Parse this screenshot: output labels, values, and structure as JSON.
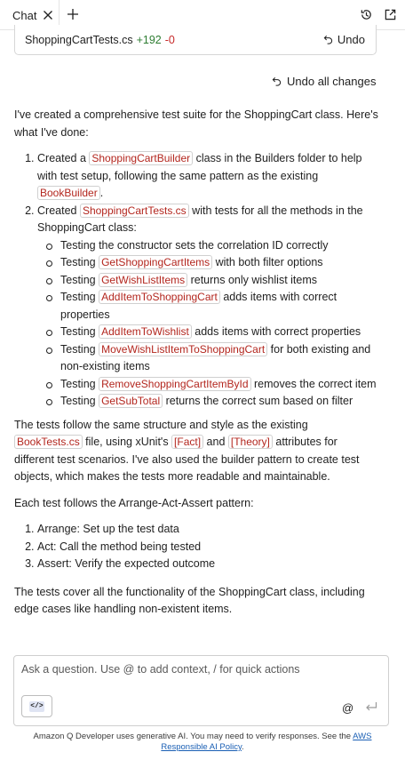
{
  "tabs": {
    "chat_label": "Chat",
    "add_icon": "plus-icon",
    "history_icon": "history-icon",
    "popout_icon": "open-in-new-window-icon"
  },
  "file_change": {
    "file_name": "ShoppingCartTests.cs",
    "added": "+192",
    "removed": "-0",
    "undo_label": "Undo"
  },
  "undo_all_label": "Undo all changes",
  "message": {
    "intro": "I've created a comprehensive test suite for the ShoppingCart class. Here's what I've done:",
    "step1": {
      "t1": "Created a ",
      "c1": "ShoppingCartBuilder",
      "t2": " class in the Builders folder to help with test setup, following the same pattern as the existing ",
      "c2": "BookBuilder",
      "t3": "."
    },
    "step2": {
      "t1": "Created ",
      "c1": "ShoppingCartTests.cs",
      "t2": " with tests for all the methods in the ShoppingCart class:"
    },
    "subs": [
      {
        "pre": "Testing the constructor sets the correlation ID correctly",
        "code": "",
        "post": ""
      },
      {
        "pre": "Testing ",
        "code": "GetShoppingCartItems",
        "post": " with both filter options"
      },
      {
        "pre": "Testing ",
        "code": "GetWishListItems",
        "post": " returns only wishlist items"
      },
      {
        "pre": "Testing ",
        "code": "AddItemToShoppingCart",
        "post": " adds items with correct properties"
      },
      {
        "pre": "Testing ",
        "code": "AddItemToWishlist",
        "post": " adds items with correct properties"
      },
      {
        "pre": "Testing ",
        "code": "MoveWishListItemToShoppingCart",
        "post": " for both existing and non-existing items"
      },
      {
        "pre": "Testing ",
        "code": "RemoveShoppingCartItemById",
        "post": " removes the correct item"
      },
      {
        "pre": "Testing ",
        "code": "GetSubTotal",
        "post": " returns the correct sum based on filter"
      }
    ],
    "para2": {
      "t1": "The tests follow the same structure and style as the existing ",
      "c1": "BookTests.cs",
      "t2": " file, using xUnit's ",
      "c2": "[Fact]",
      "t3": " and ",
      "c3": "[Theory]",
      "t4": " attributes for different test scenarios. I've also used the builder pattern to create test objects, which makes the tests more readable and maintainable."
    },
    "para3": "Each test follows the Arrange-Act-Assert pattern:",
    "aaa": [
      "Arrange: Set up the test data",
      "Act: Call the method being tested",
      "Assert: Verify the expected outcome"
    ],
    "para4": "The tests cover all the functionality of the ShoppingCart class, including edge cases like handling non-existent items."
  },
  "input": {
    "placeholder": "Ask a question. Use @ to add context, / for quick actions",
    "value": "",
    "code_button_label": "</>",
    "at_label": "@"
  },
  "footer": {
    "text": "Amazon Q Developer uses generative AI. You may need to verify responses. See the ",
    "link": "AWS Responsible AI Policy",
    "end": "."
  },
  "colors": {
    "code_text": "#b3261e",
    "added": "#2e7d32",
    "removed": "#c62828",
    "link": "#1a5fb4"
  }
}
